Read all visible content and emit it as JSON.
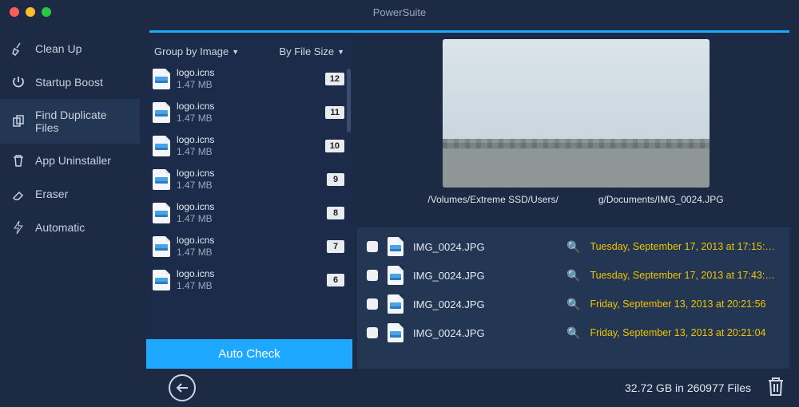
{
  "window": {
    "title": "PowerSuite",
    "traffic": {
      "close": "#ff5f57",
      "min": "#febc2e",
      "max": "#28c840"
    }
  },
  "sidebar": {
    "items": [
      {
        "label": "Clean Up",
        "icon": "broom-icon"
      },
      {
        "label": "Startup Boost",
        "icon": "power-icon"
      },
      {
        "label": "Find Duplicate\nFiles",
        "icon": "duplicate-files-icon"
      },
      {
        "label": "App Uninstaller",
        "icon": "trash-icon"
      },
      {
        "label": "Eraser",
        "icon": "eraser-icon"
      },
      {
        "label": "Automatic",
        "icon": "bolt-icon"
      }
    ],
    "active_index": 2
  },
  "list_panel": {
    "group_label": "Group by Image",
    "sort_label": "By File Size",
    "items": [
      {
        "name": "logo.icns",
        "size": "1.47 MB",
        "count": "12"
      },
      {
        "name": "logo.icns",
        "size": "1.47 MB",
        "count": "11"
      },
      {
        "name": "logo.icns",
        "size": "1.47 MB",
        "count": "10"
      },
      {
        "name": "logo.icns",
        "size": "1.47 MB",
        "count": "9"
      },
      {
        "name": "logo.icns",
        "size": "1.47 MB",
        "count": "8"
      },
      {
        "name": "logo.icns",
        "size": "1.47 MB",
        "count": "7"
      },
      {
        "name": "logo.icns",
        "size": "1.47 MB",
        "count": "6"
      }
    ],
    "auto_check_label": "Auto Check"
  },
  "preview": {
    "path_left": "/Volumes/Extreme SSD/Users/",
    "path_right": "g/Documents/IMG_0024.JPG"
  },
  "duplicates": [
    {
      "name": "IMG_0024.JPG",
      "date": "Tuesday, September 17, 2013 at 17:15:…"
    },
    {
      "name": "IMG_0024.JPG",
      "date": "Tuesday, September 17, 2013 at 17:43:…"
    },
    {
      "name": "IMG_0024.JPG",
      "date": "Friday, September 13, 2013 at 20:21:56"
    },
    {
      "name": "IMG_0024.JPG",
      "date": "Friday, September 13, 2013 at 20:21:04"
    }
  ],
  "summary": "32.72 GB in 260977 Files"
}
